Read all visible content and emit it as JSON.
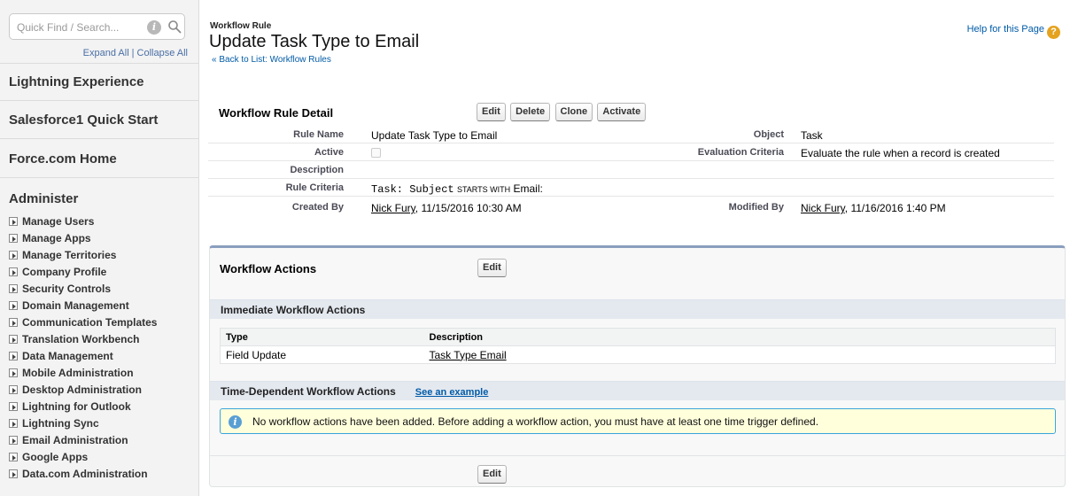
{
  "sidebar": {
    "search_placeholder": "Quick Find / Search...",
    "info_glyph": "i",
    "expand_all": "Expand All",
    "separator": "|",
    "collapse_all": "Collapse All",
    "sections": [
      "Lightning Experience",
      "Salesforce1 Quick Start",
      "Force.com Home"
    ],
    "administer_title": "Administer",
    "administer_items": [
      "Manage Users",
      "Manage Apps",
      "Manage Territories",
      "Company Profile",
      "Security Controls",
      "Domain Management",
      "Communication Templates",
      "Translation Workbench",
      "Data Management",
      "Mobile Administration",
      "Desktop Administration",
      "Lightning for Outlook",
      "Lightning Sync",
      "Email Administration",
      "Google Apps",
      "Data.com Administration"
    ]
  },
  "header": {
    "label": "Workflow Rule",
    "title": "Update Task Type to Email",
    "back_prefix": "«",
    "back_link": "Back to List: Workflow Rules",
    "help": "Help for this Page",
    "help_glyph": "?"
  },
  "detail": {
    "title": "Workflow Rule Detail",
    "buttons": [
      "Edit",
      "Delete",
      "Clone",
      "Activate"
    ],
    "rule_name_label": "Rule Name",
    "rule_name": "Update Task Type to Email",
    "object_label": "Object",
    "object": "Task",
    "active_label": "Active",
    "eval_label": "Evaluation Criteria",
    "eval": "Evaluate the rule when a record is created",
    "description_label": "Description",
    "rule_criteria_label": "Rule Criteria",
    "criteria_field": "Task: Subject",
    "criteria_op": "STARTS WITH",
    "criteria_value": "Email:",
    "created_by_label": "Created By",
    "created_by_name": "Nick Fury",
    "created_by_date": ", 11/15/2016 10:30 AM",
    "modified_by_label": "Modified By",
    "modified_by_name": "Nick Fury",
    "modified_by_date": ", 11/16/2016 1:40 PM"
  },
  "workflow_actions": {
    "title": "Workflow Actions",
    "edit": "Edit",
    "immediate_title": "Immediate Workflow Actions",
    "table_headers": [
      "Type",
      "Description"
    ],
    "table_rows": [
      {
        "type": "Field Update",
        "description": "Task Type Email"
      }
    ],
    "time_dependent_title": "Time-Dependent Workflow Actions",
    "see_example": "See an example",
    "info_glyph": "i",
    "info_message": "No workflow actions have been added. Before adding a workflow action, you must have at least one time trigger defined."
  },
  "colors": {
    "link": "#015ba7",
    "panel_accent": "#8a9ebe",
    "info_bg": "#ffffdc",
    "help_icon": "#e5a21f"
  }
}
